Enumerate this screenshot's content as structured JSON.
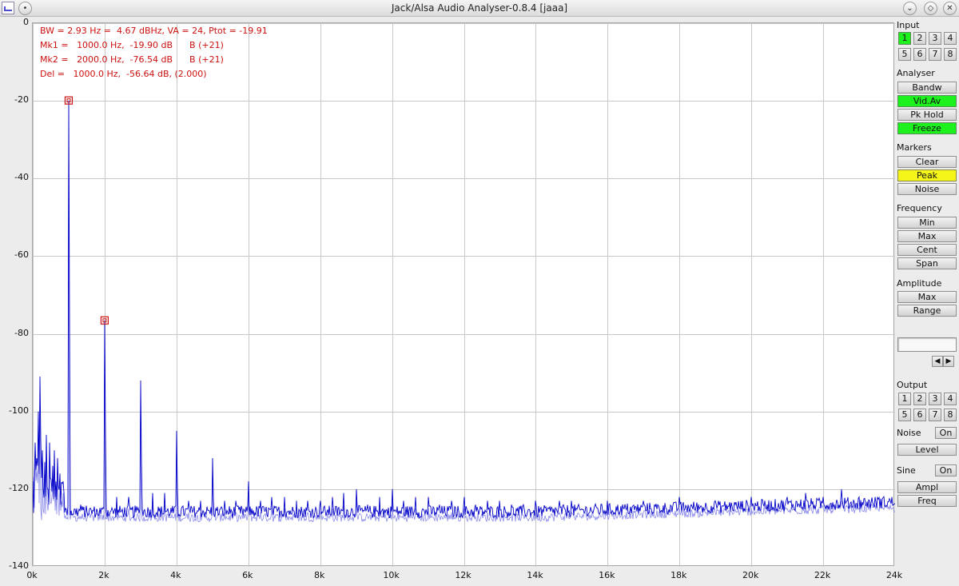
{
  "window": {
    "title": "Jack/Alsa Audio Analyser-0.8.4  [jaaa]",
    "controls": [
      "menu-icon",
      "minimize-icon",
      "restore-icon",
      "close-icon"
    ]
  },
  "readout": {
    "line1": "BW = 2.93 Hz =  4.67 dBHz, VA = 24, Ptot = -19.91",
    "line2": "Mk1 =   1000.0 Hz,  -19.90 dB      B (+21)",
    "line3": "Mk2 =   2000.0 Hz,  -76.54 dB      B (+21)",
    "line4": "Del =   1000.0 Hz,  -56.64 dB, (2.000)",
    "color": "#cc1010"
  },
  "chart_data": {
    "type": "line",
    "x_tick_labels": [
      "0k",
      "2k",
      "4k",
      "6k",
      "8k",
      "10k",
      "12k",
      "14k",
      "16k",
      "18k",
      "20k",
      "22k",
      "24k"
    ],
    "y_tick_labels": [
      "0",
      "-20",
      "-40",
      "-60",
      "-80",
      "-100",
      "-120",
      "-140"
    ],
    "xlim": [
      0,
      24000
    ],
    "ylim": [
      -140,
      0
    ],
    "grid": true,
    "line_color": "#0000c8",
    "noise_floor_db": -127,
    "peaks": [
      {
        "x": 70,
        "y": -108
      },
      {
        "x": 120,
        "y": -112
      },
      {
        "x": 160,
        "y": -100
      },
      {
        "x": 200,
        "y": -91
      },
      {
        "x": 260,
        "y": -110
      },
      {
        "x": 330,
        "y": -113
      },
      {
        "x": 380,
        "y": -106
      },
      {
        "x": 460,
        "y": -108
      },
      {
        "x": 550,
        "y": -114
      },
      {
        "x": 600,
        "y": -110
      },
      {
        "x": 690,
        "y": -112
      },
      {
        "x": 760,
        "y": -116
      },
      {
        "x": 850,
        "y": -118
      },
      {
        "x": 1000,
        "y": -19.9
      },
      {
        "x": 1330,
        "y": -124
      },
      {
        "x": 2000,
        "y": -76.5
      },
      {
        "x": 2330,
        "y": -122
      },
      {
        "x": 2660,
        "y": -122
      },
      {
        "x": 3000,
        "y": -92
      },
      {
        "x": 3330,
        "y": -121
      },
      {
        "x": 3660,
        "y": -121
      },
      {
        "x": 4000,
        "y": -105
      },
      {
        "x": 4330,
        "y": -123
      },
      {
        "x": 4660,
        "y": -123
      },
      {
        "x": 5000,
        "y": -112
      },
      {
        "x": 5330,
        "y": -123
      },
      {
        "x": 5660,
        "y": -123
      },
      {
        "x": 6000,
        "y": -118
      },
      {
        "x": 6330,
        "y": -123
      },
      {
        "x": 6660,
        "y": -122
      },
      {
        "x": 7000,
        "y": -122
      },
      {
        "x": 7330,
        "y": -123
      },
      {
        "x": 7660,
        "y": -123
      },
      {
        "x": 8000,
        "y": -123
      },
      {
        "x": 8330,
        "y": -122
      },
      {
        "x": 8660,
        "y": -121
      },
      {
        "x": 9000,
        "y": -120
      },
      {
        "x": 9330,
        "y": -124
      },
      {
        "x": 9660,
        "y": -122
      },
      {
        "x": 10000,
        "y": -120
      },
      {
        "x": 10330,
        "y": -123
      },
      {
        "x": 10660,
        "y": -122
      },
      {
        "x": 11000,
        "y": -122
      },
      {
        "x": 11330,
        "y": -124
      },
      {
        "x": 11660,
        "y": -123
      },
      {
        "x": 12000,
        "y": -122
      },
      {
        "x": 12330,
        "y": -124
      },
      {
        "x": 12660,
        "y": -123
      },
      {
        "x": 13000,
        "y": -123
      },
      {
        "x": 13330,
        "y": -124
      },
      {
        "x": 13660,
        "y": -124
      },
      {
        "x": 14000,
        "y": -123
      },
      {
        "x": 14660,
        "y": -123
      },
      {
        "x": 15000,
        "y": -123
      },
      {
        "x": 16000,
        "y": -123
      },
      {
        "x": 17000,
        "y": -123
      },
      {
        "x": 18000,
        "y": -122
      },
      {
        "x": 19000,
        "y": -123
      },
      {
        "x": 20000,
        "y": -122
      },
      {
        "x": 21000,
        "y": -122
      },
      {
        "x": 21500,
        "y": -121
      },
      {
        "x": 22000,
        "y": -122
      },
      {
        "x": 22500,
        "y": -120
      },
      {
        "x": 23000,
        "y": -122
      },
      {
        "x": 23500,
        "y": -122
      }
    ],
    "markers": [
      {
        "name": "Mk1",
        "x": 1000,
        "y": -19.9
      },
      {
        "name": "Mk2",
        "x": 2000,
        "y": -76.54
      }
    ]
  },
  "panel": {
    "input": {
      "label": "Input",
      "channels": [
        "1",
        "2",
        "3",
        "4",
        "5",
        "6",
        "7",
        "8"
      ],
      "selected": "1"
    },
    "analyser": {
      "label": "Analyser",
      "bandw": "Bandw",
      "vidav": "Vid.Av",
      "pkhold": "Pk Hold",
      "freeze": "Freeze"
    },
    "markers": {
      "label": "Markers",
      "clear": "Clear",
      "peak": "Peak",
      "noise": "Noise"
    },
    "frequency": {
      "label": "Frequency",
      "min": "Min",
      "max": "Max",
      "cent": "Cent",
      "span": "Span"
    },
    "amplitude": {
      "label": "Amplitude",
      "max": "Max",
      "range": "Range"
    },
    "value_field": "",
    "output": {
      "label": "Output",
      "channels": [
        "1",
        "2",
        "3",
        "4",
        "5",
        "6",
        "7",
        "8"
      ]
    },
    "noise": {
      "label": "Noise",
      "on": "On",
      "level": "Level"
    },
    "sine": {
      "label": "Sine",
      "on": "On",
      "ampl": "Ampl",
      "freq": "Freq"
    },
    "colors": {
      "active": "#1ef21e",
      "highlight": "#f5f51a"
    }
  }
}
